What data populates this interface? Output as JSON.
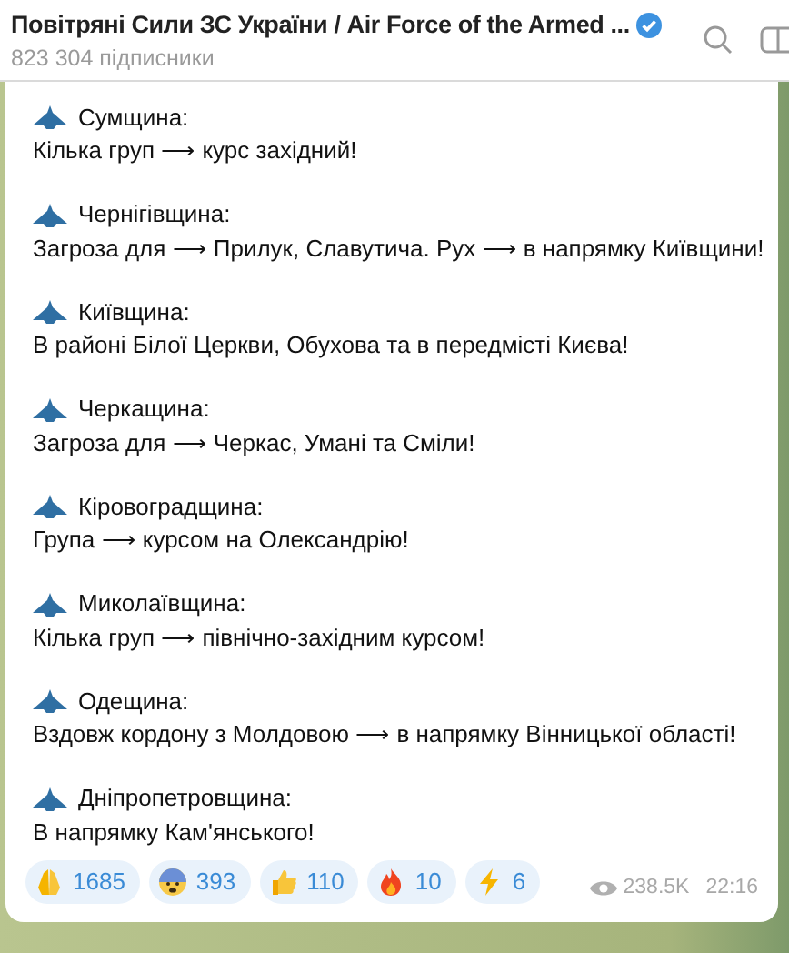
{
  "header": {
    "title": "Повітряні Сили ЗС України / Air Force of the Armed ...",
    "verified": true,
    "subtitle": "823 304 підписники"
  },
  "sections": [
    {
      "region": "Сумщина:",
      "text": "Кілька груп ⟶ курс західний!"
    },
    {
      "region": "Чернігівщина:",
      "text": "Загроза для ⟶ Прилук, Славутича. Рух ⟶ в напрямку Київщини!"
    },
    {
      "region": "Київщина:",
      "text": "В районі Білої Церкви, Обухова та в передмісті Києва!"
    },
    {
      "region": "Черкащина:",
      "text": "Загроза для ⟶ Черкас, Умані та Сміли!"
    },
    {
      "region": "Кіровоградщина:",
      "text": "Група ⟶ курсом на Олександрію!"
    },
    {
      "region": "Миколаївщина:",
      "text": "Кілька груп ⟶ північно-західним курсом!"
    },
    {
      "region": "Одещина:",
      "text": "Вздовж кордону з Молдовою ⟶ в напрямку Вінницької області!"
    },
    {
      "region": "Дніпропетровщина:",
      "text": "В напрямку Кам'янського!"
    }
  ],
  "reactions": [
    {
      "kind": "pray",
      "count": "1685"
    },
    {
      "kind": "fear",
      "count": "393"
    },
    {
      "kind": "thumbs",
      "count": "110"
    },
    {
      "kind": "fire",
      "count": "10"
    },
    {
      "kind": "bolt",
      "count": "6"
    }
  ],
  "views": "238.5K",
  "time": "22:16"
}
